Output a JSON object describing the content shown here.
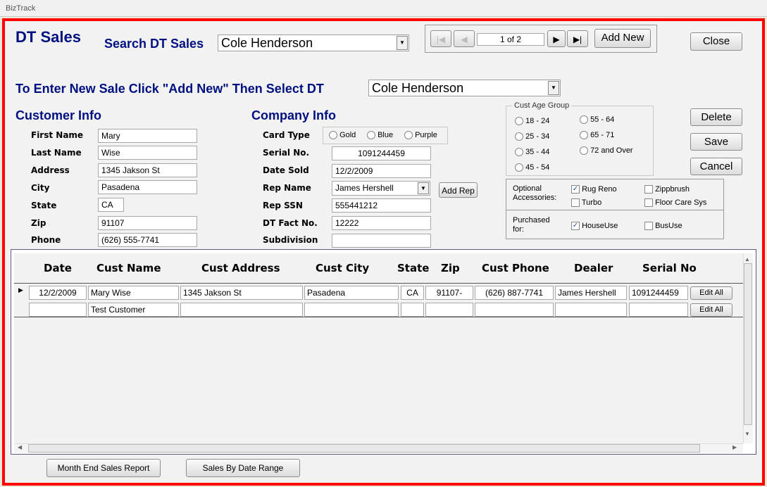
{
  "app": {
    "title": "BizTrack"
  },
  "header": {
    "title": "DT Sales",
    "search_label": "Search DT Sales",
    "search_value": "Cole Henderson",
    "record_position": "1 of 2",
    "add_new": "Add New",
    "close": "Close"
  },
  "new_sale": {
    "label": "To Enter New Sale Click \"Add New\" Then Select DT",
    "dt_value": "Cole Henderson"
  },
  "customer": {
    "title": "Customer Info",
    "fields": [
      {
        "label": "First Name",
        "value": "Mary"
      },
      {
        "label": "Last Name",
        "value": "Wise"
      },
      {
        "label": "Address",
        "value": "1345 Jakson St"
      },
      {
        "label": "City",
        "value": "Pasadena"
      },
      {
        "label": "State",
        "value": "CA"
      },
      {
        "label": "Zip",
        "value": "91107"
      },
      {
        "label": "Phone",
        "value": "(626) 555-7741"
      }
    ]
  },
  "company": {
    "title": "Company Info",
    "card_type_label": "Card Type",
    "card_options": [
      "Gold",
      "Blue",
      "Purple"
    ],
    "serial_label": "Serial No.",
    "serial_value": "1091244459",
    "date_sold_label": "Date Sold",
    "date_sold_value": "12/2/2009",
    "rep_name_label": "Rep Name",
    "rep_name_value": "James Hershell",
    "add_rep": "Add Rep",
    "rep_ssn_label": "Rep SSN",
    "rep_ssn_value": "555441212",
    "dt_fact_label": "DT Fact No.",
    "dt_fact_value": "12222",
    "subdivision_label": "Subdivision",
    "subdivision_value": ""
  },
  "age_group": {
    "title": "Cust Age Group",
    "options": [
      "18 - 24",
      "25 - 34",
      "35 - 44",
      "45 - 54",
      "55 - 64",
      "65 - 71",
      "72 and Over"
    ]
  },
  "actions": {
    "delete": "Delete",
    "save": "Save",
    "cancel": "Cancel"
  },
  "accessories": {
    "label": "Optional Accessories:",
    "items": [
      {
        "label": "Rug Reno",
        "checked": "✓"
      },
      {
        "label": "Turbo",
        "checked": ""
      },
      {
        "label": "Zippbrush",
        "checked": ""
      },
      {
        "label": "Floor Care Sys",
        "checked": ""
      }
    ],
    "purchased_label": "Purchased for:",
    "purchased": [
      {
        "label": "HouseUse",
        "checked": "✓"
      },
      {
        "label": "BusUse",
        "checked": ""
      }
    ]
  },
  "grid": {
    "headers": [
      "Date",
      "Cust Name",
      "Cust Address",
      "Cust City",
      "State",
      "Zip",
      "Cust Phone",
      "Dealer",
      "Serial No"
    ],
    "rows": [
      {
        "date": "12/2/2009",
        "name": "Mary Wise",
        "address": "1345 Jakson St",
        "city": "Pasadena",
        "state": "CA",
        "zip": "91107-",
        "phone": "(626) 887-7741",
        "dealer": "James Hershell",
        "serial": "1091244459",
        "edit": "Edit All"
      },
      {
        "date": "",
        "name": "Test Customer",
        "address": "",
        "city": "",
        "state": "",
        "zip": "",
        "phone": "",
        "dealer": "",
        "serial": "",
        "edit": "Edit All"
      }
    ]
  },
  "footer": {
    "month_end": "Month End Sales Report",
    "date_range": "Sales By Date Range"
  }
}
